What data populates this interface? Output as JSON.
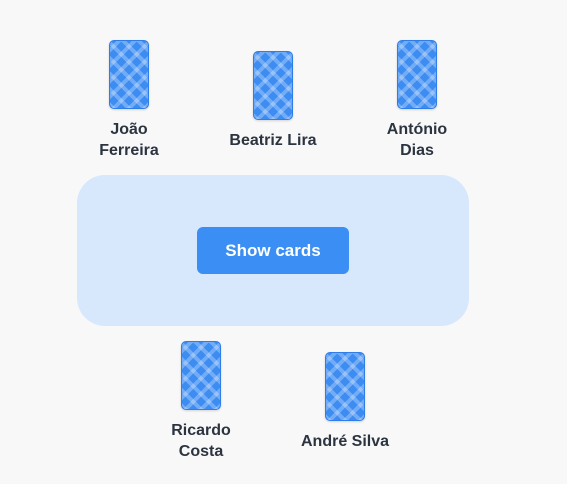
{
  "players": [
    {
      "name": "João Ferreira",
      "line1": "João",
      "line2": "Ferreira"
    },
    {
      "name": "Beatriz Lira",
      "line1": "Beatriz Lira"
    },
    {
      "name": "António Dias",
      "line1": "António",
      "line2": "Dias"
    },
    {
      "name": "Ricardo Costa",
      "line1": "Ricardo",
      "line2": "Costa"
    },
    {
      "name": "André Silva",
      "line1": "André Silva"
    }
  ],
  "table": {
    "button_label": "Show cards"
  },
  "colors": {
    "background": "#f8f8f9",
    "table": "#d7e8fd",
    "button": "#3b8ef3",
    "card_back": "#3d8cf2",
    "name_text": "#2c3440"
  }
}
